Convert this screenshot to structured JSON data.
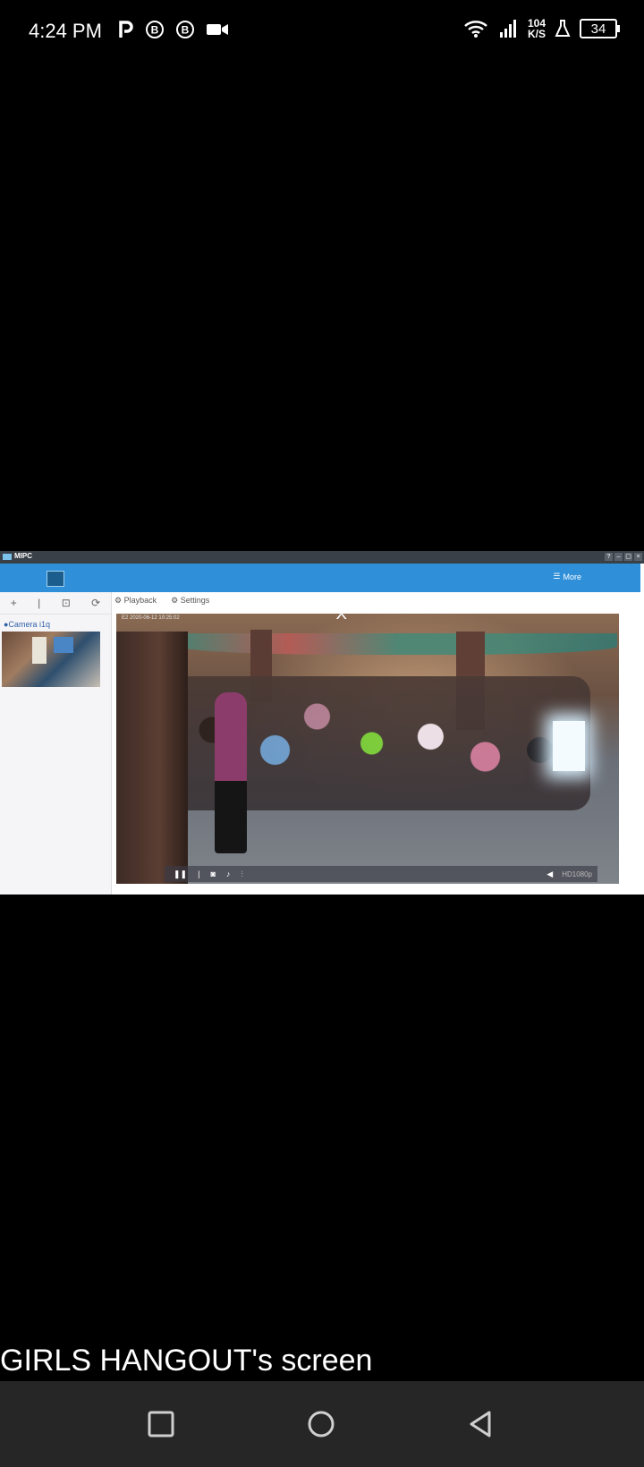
{
  "status_bar": {
    "time": "4:24 PM",
    "left_icons": [
      "p-icon",
      "b-icon",
      "b-icon",
      "video-icon"
    ],
    "network_speed_value": "104",
    "network_speed_unit": "K/S",
    "battery": "34"
  },
  "shared_window": {
    "title": "MIPC",
    "app_bar": {
      "more_label": "More"
    },
    "sidebar": {
      "tools": [
        "+",
        "|",
        "⊡",
        "⟳"
      ],
      "camera_label": "●Camera i1q"
    },
    "toolbar": {
      "playback_label": "Playback",
      "settings_label": "Settings"
    },
    "video": {
      "osd_text": "E2 2020-06-12 10:25:02",
      "quality_label": "HD1080p"
    }
  },
  "caption": "GIRLS HANGOUT's screen",
  "colors": {
    "app_bar": "#2f8fd8",
    "nav_bar": "#262626"
  }
}
